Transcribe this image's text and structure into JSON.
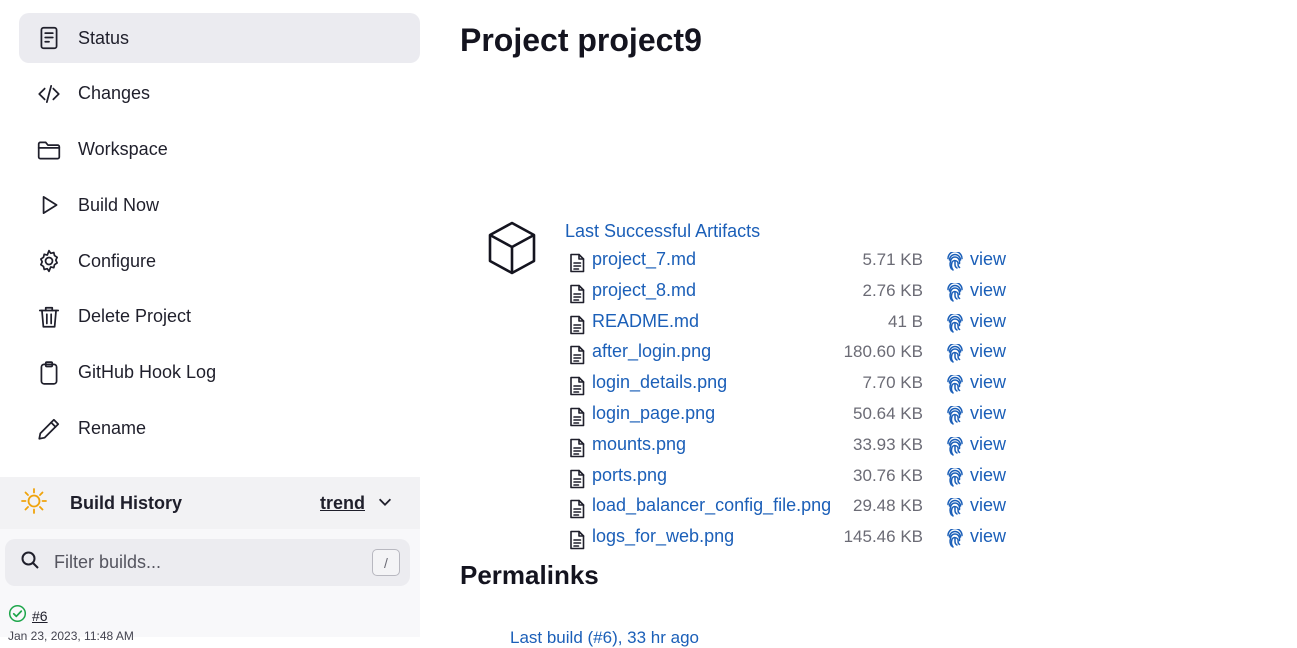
{
  "sidebar": {
    "tasks": [
      {
        "label": "Status",
        "icon": "document-icon",
        "active": true
      },
      {
        "label": "Changes",
        "icon": "code-icon"
      },
      {
        "label": "Workspace",
        "icon": "folder-icon"
      },
      {
        "label": "Build Now",
        "icon": "play-icon"
      },
      {
        "label": "Configure",
        "icon": "gear-icon"
      },
      {
        "label": "Delete Project",
        "icon": "trash-icon"
      },
      {
        "label": "GitHub Hook Log",
        "icon": "clipboard-icon"
      },
      {
        "label": "Rename",
        "icon": "pencil-icon"
      }
    ],
    "build_history": {
      "title": "Build History",
      "trend_label": "trend",
      "filter_placeholder": "Filter builds...",
      "filter_shortcut": "/",
      "builds": [
        {
          "number": "#6",
          "status": "success",
          "date": "Jan 23, 2023, 11:48 AM"
        }
      ]
    }
  },
  "main": {
    "title": "Project project9",
    "artifacts": {
      "heading": "Last Successful Artifacts",
      "view_label": "view",
      "files": [
        {
          "name": "project_7.md",
          "size": "5.71 KB"
        },
        {
          "name": "project_8.md",
          "size": "2.76 KB"
        },
        {
          "name": "README.md",
          "size": "41 B"
        },
        {
          "name": "after_login.png",
          "size": "180.60 KB"
        },
        {
          "name": "login_details.png",
          "size": "7.70 KB"
        },
        {
          "name": "login_page.png",
          "size": "50.64 KB"
        },
        {
          "name": "mounts.png",
          "size": "33.93 KB"
        },
        {
          "name": "ports.png",
          "size": "30.76 KB"
        },
        {
          "name": "load_balancer_config_file.png",
          "size": "29.48 KB"
        },
        {
          "name": "logs_for_web.png",
          "size": "145.46 KB"
        }
      ]
    },
    "permalinks": {
      "title": "Permalinks",
      "items": [
        "Last build (#6), 33 hr ago"
      ]
    }
  },
  "colors": {
    "link": "#1b5fb8",
    "success": "#1ea64b",
    "sun": "#f0a30a",
    "active_bg": "#ebebf0"
  }
}
